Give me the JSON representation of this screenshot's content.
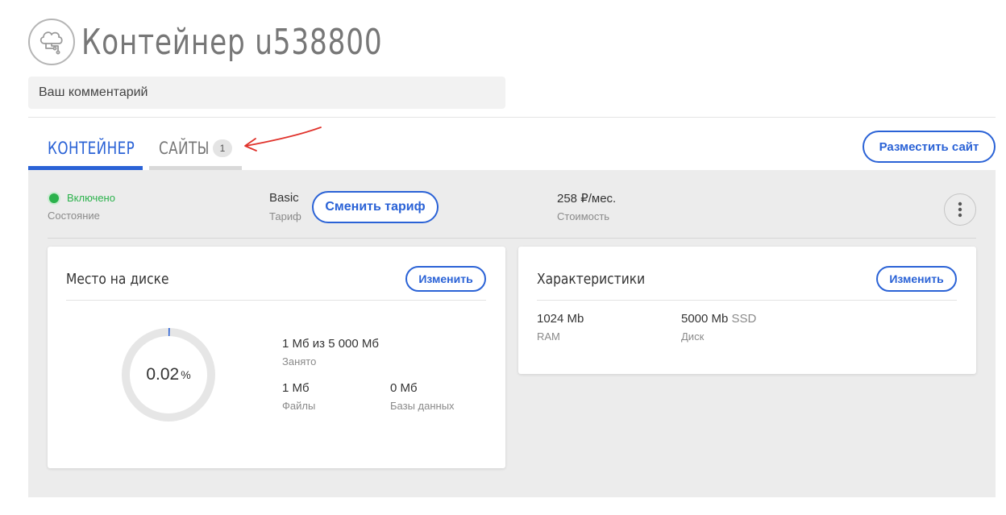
{
  "header": {
    "title": "Контейнер u538800",
    "logo_icon": "cloud-container-icon"
  },
  "comment": {
    "placeholder": "Ваш комментарий"
  },
  "tabs": [
    {
      "label": "КОНТЕЙНЕР",
      "active": true
    },
    {
      "label": "САЙТЫ",
      "count": "1",
      "active": false
    }
  ],
  "actions": {
    "place_site": "Разместить сайт"
  },
  "summary": {
    "status_value": "Включено",
    "status_label": "Состояние",
    "tariff_value": "Basic",
    "tariff_label": "Тариф",
    "change_tariff": "Сменить тариф",
    "cost_value": "258 ₽/мес.",
    "cost_label": "Стоимость",
    "more_icon": "vertical-dots-icon"
  },
  "disk": {
    "title": "Место на диске",
    "change": "Изменить",
    "usage_number": "0.02",
    "usage_unit": "%",
    "usage_fraction": 0.0002,
    "occupied_value": "1 Мб из 5 000 Мб",
    "occupied_label": "Занято",
    "files_value": "1 Мб",
    "files_label": "Файлы",
    "db_value": "0 Мб",
    "db_label": "Базы данных"
  },
  "specs": {
    "title": "Характеристики",
    "change": "Изменить",
    "ram_value": "1024 Mb",
    "ram_label": "RAM",
    "disk_value": "5000 Mb",
    "disk_type": "SSD",
    "disk_label": "Диск"
  },
  "colors": {
    "accent": "#2a62d6",
    "status_green": "#2bb24c",
    "panel_bg": "#ececec",
    "annotation_red": "#e0322b"
  }
}
